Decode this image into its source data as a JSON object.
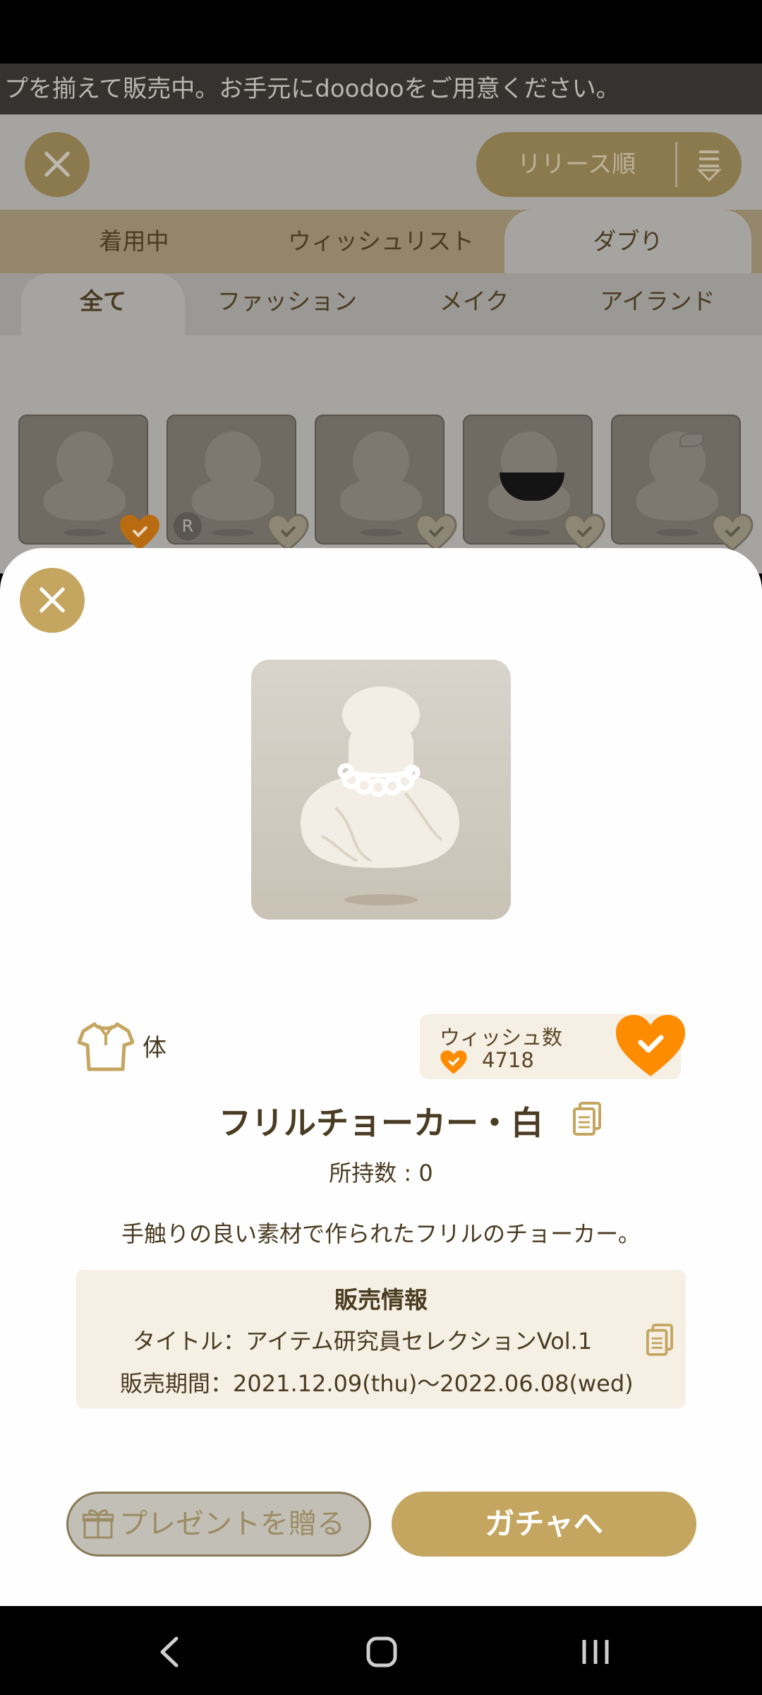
{
  "ticker": {
    "text": "プを揃えて販売中。お手元にdoodooをご用意ください。"
  },
  "background": {
    "sort_label": "リリース順",
    "tabs": [
      "着用中",
      "ウィッシュリスト",
      "ダブり"
    ],
    "active_tab": "ダブり",
    "filters": [
      "全て",
      "ファッション",
      "メイク",
      "アイランド"
    ],
    "active_filter": "全て",
    "badge_r": "R"
  },
  "item": {
    "category": "体",
    "wish_label": "ウィッシュ数",
    "wish_count": "4718",
    "name": "フリルチョーカー・白",
    "owned": "所持数 : 0",
    "description": "手触りの良い素材で作られたフリルのチョーカー。"
  },
  "sale": {
    "heading": "販売情報",
    "title": "タイトル：アイテム研究員セレクションVol.1",
    "period": "販売期間：2021.12.09(thu)〜2022.06.08(wed)"
  },
  "buttons": {
    "present": "プレゼントを贈る",
    "gacha": "ガチャへ"
  },
  "colors": {
    "accent": "#c5a660",
    "wish_orange": "#ff8c00",
    "text_brown": "#4a3c22",
    "panel_beige": "#f5efe4"
  },
  "icons": [
    "close-icon",
    "sort-icon",
    "shirt-icon",
    "heart-check-icon",
    "copy-icon",
    "gift-icon",
    "nav-back-icon",
    "nav-home-icon",
    "nav-recents-icon"
  ]
}
